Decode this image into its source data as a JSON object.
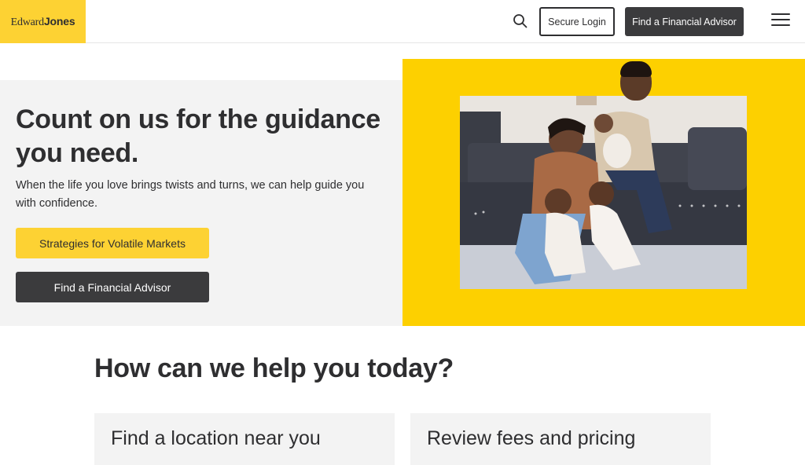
{
  "header": {
    "logo_part1": "Edward",
    "logo_part2": "Jones",
    "secure_login": "Secure Login",
    "find_advisor": "Find a Financial Advisor"
  },
  "hero": {
    "title": "Count on us for the guidance you need.",
    "subtitle": "When the life you love brings twists and turns, we can help guide you with confidence.",
    "primary_button": "Strategies for Volatile Markets",
    "secondary_button": "Find a Financial Advisor"
  },
  "help": {
    "title": "How can we help you today?",
    "cards": [
      {
        "label": "Find a location near you"
      },
      {
        "label": "Review fees and pricing"
      }
    ]
  },
  "colors": {
    "brand_yellow": "#fdd233",
    "dark": "#3b3b3d",
    "light_gray": "#f3f3f3"
  }
}
